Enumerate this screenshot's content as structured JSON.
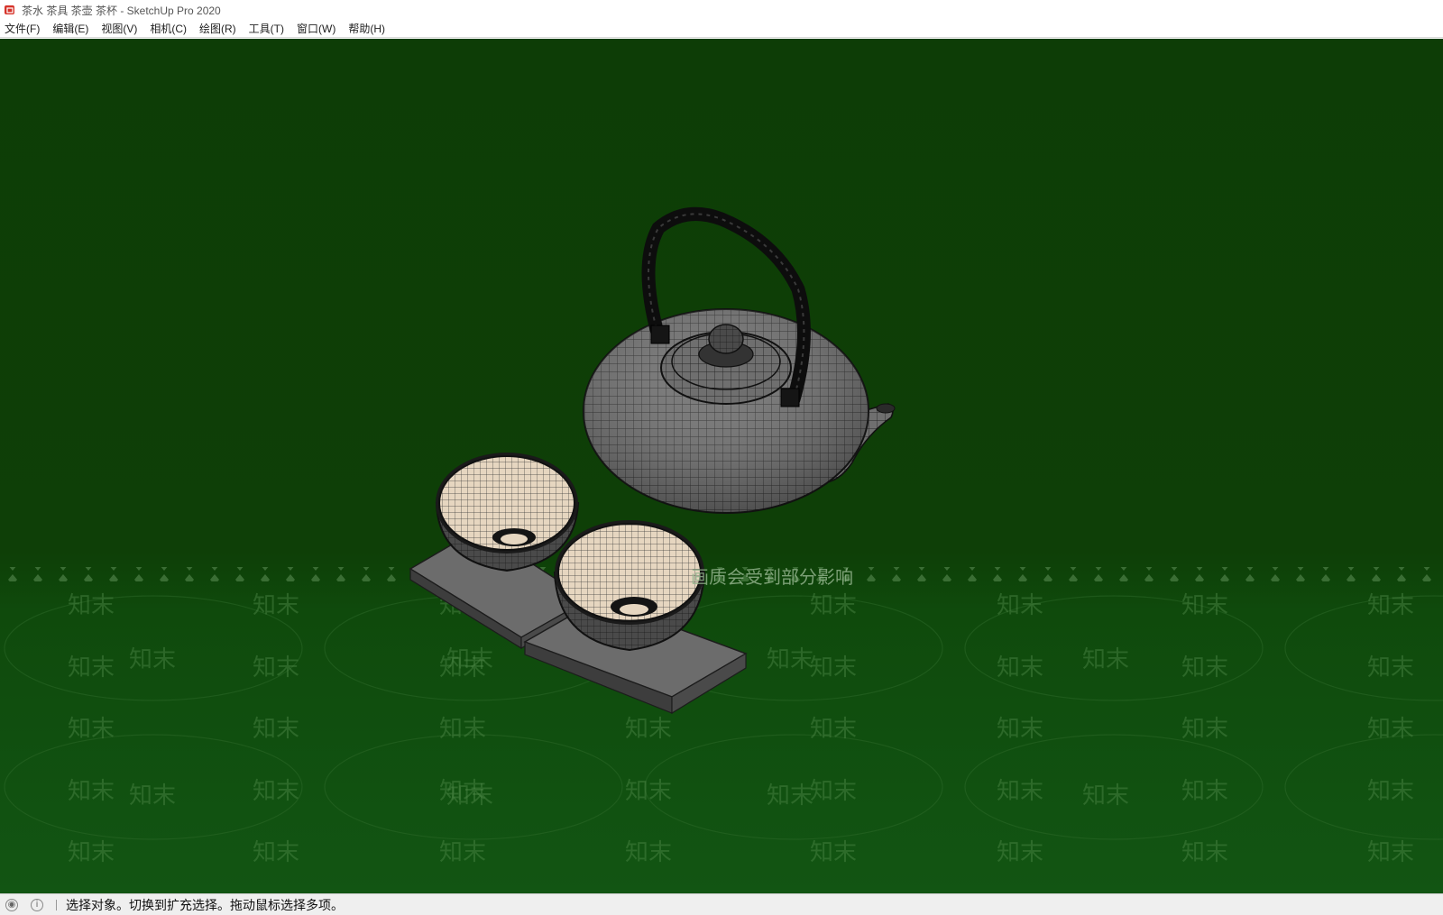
{
  "window": {
    "title": "茶水 茶具 茶壶 茶杯 - SketchUp Pro 2020"
  },
  "menu": {
    "items": [
      {
        "label": "文件(F)"
      },
      {
        "label": "编辑(E)"
      },
      {
        "label": "视图(V)"
      },
      {
        "label": "相机(C)"
      },
      {
        "label": "绘图(R)"
      },
      {
        "label": "工具(T)"
      },
      {
        "label": "窗口(W)"
      },
      {
        "label": "帮助(H)"
      }
    ]
  },
  "viewport": {
    "banner_text": "画质会受到部分影响",
    "watermark_text": "知末",
    "background_color": "#0d3d06"
  },
  "status": {
    "geo_icon": "globe-icon",
    "info_icon": "info-icon",
    "message": "选择对象。切换到扩充选择。拖动鼠标选择多项。"
  }
}
